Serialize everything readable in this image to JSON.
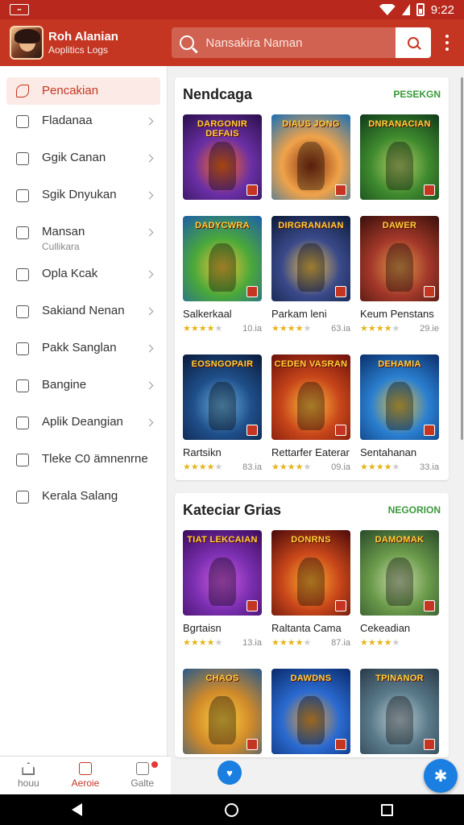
{
  "status_bar": {
    "time": "9:22",
    "left_icon": "app-notification-icon"
  },
  "app_bar": {
    "user_name": "Roh Alanian",
    "user_subtitle": "Aoplitics Logs",
    "search_placeholder": "Nansakira Naman",
    "search_icon": "search-icon",
    "more_icon": "more-vert-icon"
  },
  "sidebar": {
    "items": [
      {
        "label": "Pencakian",
        "sub": "",
        "icon": "heart-icon",
        "active": true
      },
      {
        "label": "Fladanaa",
        "sub": "",
        "icon": "share-icon"
      },
      {
        "label": "Ggik Canan",
        "sub": "",
        "icon": "box-icon"
      },
      {
        "label": "Sgik Dnyukan",
        "sub": "",
        "icon": "document-icon"
      },
      {
        "label": "Mansan",
        "sub": "Cullikara",
        "icon": "gallery-icon"
      },
      {
        "label": "Opla Kcak",
        "sub": "",
        "icon": "search-icon"
      },
      {
        "label": "Sakiand Nenan",
        "sub": "",
        "icon": "person-icon"
      },
      {
        "label": "Pakk Sanglan",
        "sub": "",
        "icon": "calendar-icon"
      },
      {
        "label": "Bangine",
        "sub": "",
        "icon": "pencil-icon"
      },
      {
        "label": "Aplik Deangian",
        "sub": "",
        "icon": "award-icon"
      },
      {
        "label": "Tleke C0 ämnenrne",
        "sub": "",
        "icon": "image-icon"
      },
      {
        "label": "Kerala Salang",
        "sub": "",
        "icon": "search-icon"
      }
    ]
  },
  "sections": [
    {
      "title": "Nendcaga",
      "link": "PESEKGN",
      "rows": [
        [
          {
            "art_text": "DARGONIR DEFAIS",
            "name": "",
            "count": "",
            "colors": [
              "#2a0f4a",
              "#6a2fa5",
              "#ff6a1a"
            ]
          },
          {
            "art_text": "DIAUS JONG",
            "name": "",
            "count": "",
            "colors": [
              "#1a6fb5",
              "#f0a34a",
              "#8a3010"
            ]
          },
          {
            "art_text": "DNRANACIAN",
            "name": "",
            "count": "",
            "colors": [
              "#0e3a1a",
              "#3f8a2e",
              "#b7d06a"
            ]
          }
        ],
        [
          {
            "art_text": "DADYCWRA",
            "name": "Salkerkaal",
            "count": "10.ia",
            "rating": 4,
            "colors": [
              "#1d5fa8",
              "#4aa83a",
              "#f3c33a"
            ]
          },
          {
            "art_text": "DIRGRANAIAN",
            "name": "Parkam leni",
            "count": "63.ia",
            "rating": 4,
            "colors": [
              "#0c1a3a",
              "#3a4a8a",
              "#f2c14a"
            ]
          },
          {
            "art_text": "DAWER",
            "name": "Keum Penstans",
            "count": "29.ie",
            "rating": 4,
            "colors": [
              "#3a0f0a",
              "#a3382a",
              "#e29a4a"
            ]
          }
        ],
        [
          {
            "art_text": "EOSNGOPAIR",
            "name": "Rartsikn",
            "count": "83.ia",
            "rating": 4,
            "colors": [
              "#0a1a3a",
              "#1f4f8a",
              "#6ab0e0"
            ]
          },
          {
            "art_text": "CEDEN VASRAN",
            "name": "Rettarfer Eaterar",
            "count": "09.ia",
            "rating": 4,
            "colors": [
              "#6a0f0a",
              "#c8461a",
              "#ffc040"
            ]
          },
          {
            "art_text": "DEHAMIA",
            "name": "Sentahanan",
            "count": "33.ia",
            "rating": 4,
            "colors": [
              "#0a2f6a",
              "#2a7fd0",
              "#e8c040"
            ]
          }
        ]
      ]
    },
    {
      "title": "Kateciar Grias",
      "link": "NEGORION",
      "rows": [
        [
          {
            "art_text": "TIAT LEKCAIAN",
            "name": "Bgrtaisn",
            "count": "13.ia",
            "rating": 4,
            "colors": [
              "#3a0a5a",
              "#7a2fb0",
              "#d05ae0"
            ]
          },
          {
            "art_text": "DONRNS",
            "name": "Raltanta Cama",
            "count": "87.ia",
            "rating": 4,
            "colors": [
              "#4a0a0a",
              "#c8461a",
              "#ffb030"
            ]
          },
          {
            "art_text": "DAMOMAK",
            "name": "Cekeadian",
            "count": "",
            "rating": 4,
            "colors": [
              "#2a4a2a",
              "#6a9a4a",
              "#d0e0b0"
            ]
          }
        ],
        [
          {
            "art_text": "CHAOS",
            "name": "",
            "count": "",
            "colors": [
              "#2a5a8a",
              "#d08a2a",
              "#ffd040"
            ]
          },
          {
            "art_text": "DAWDNS",
            "name": "",
            "count": "",
            "colors": [
              "#0a2a6a",
              "#2a6ad0",
              "#f0a030"
            ]
          },
          {
            "art_text": "TPINANOR",
            "name": "",
            "count": "",
            "colors": [
              "#2a3a4a",
              "#5a7a8a",
              "#c0d0d8"
            ]
          }
        ]
      ]
    }
  ],
  "bottom_nav": [
    {
      "label": "houu",
      "icon": "home-icon",
      "active": false
    },
    {
      "label": "Aeroie",
      "icon": "briefcase-icon",
      "active": true
    },
    {
      "label": "Galte",
      "icon": "chart-icon",
      "active": false,
      "badge": true
    }
  ],
  "fab_icon": "accessibility-icon",
  "colors": {
    "accent": "#c43622",
    "status_bar": "#b8281c",
    "link_green": "#3a9a3a",
    "star": "#e7b51c"
  }
}
